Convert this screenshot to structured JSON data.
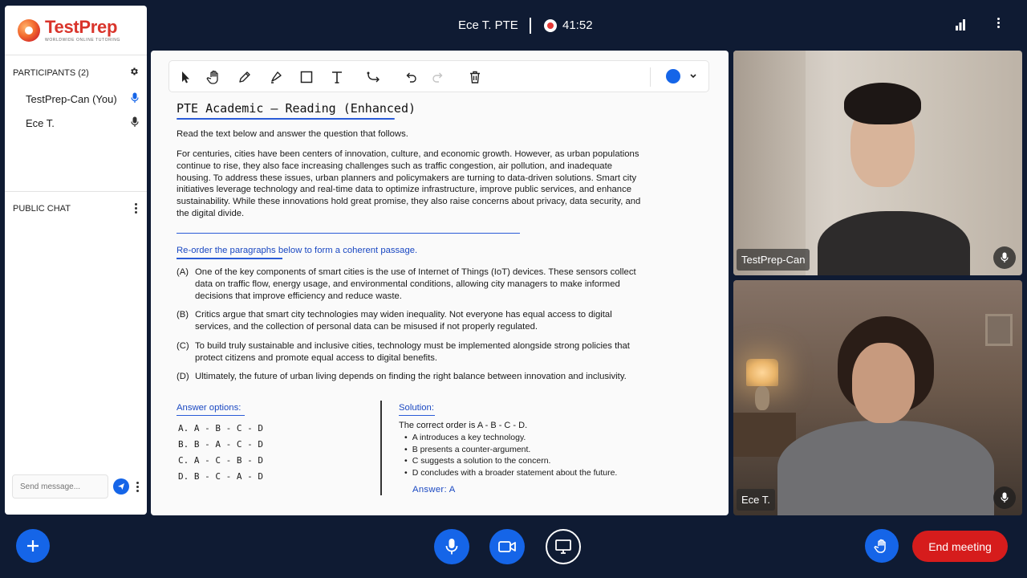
{
  "brand": {
    "title": "TestPrep",
    "subtitle": "WORLDWIDE ONLINE TUTORING"
  },
  "header": {
    "title": "Ece T. PTE",
    "timer": "41:52"
  },
  "participants": {
    "heading": "PARTICIPANTS (2)",
    "list": [
      {
        "name": "TestPrep-Can (You)",
        "mic_color": "#1565e8"
      },
      {
        "name": "Ece T.",
        "mic_color": "#333333"
      }
    ]
  },
  "chat": {
    "heading": "PUBLIC CHAT",
    "placeholder": "Send message..."
  },
  "whiteboard": {
    "title": "PTE  Academic  –  Reading  (Enhanced)",
    "intro": "Read the text below and answer the question that follows.",
    "passage": "For centuries, cities have been centers of innovation, culture, and economic growth. However, as urban populations continue to rise, they also face increasing challenges such as traffic congestion, air pollution, and inadequate housing. To address these issues, urban planners and policymakers are turning to data-driven solutions. Smart city initiatives leverage technology and real-time data to optimize infrastructure, improve public services, and enhance sustainability. While these innovations hold great promise, they also raise concerns about privacy, data security, and the digital divide.",
    "instruction": "Re-order the paragraphs below to form a coherent passage.",
    "options": [
      {
        "letter": "(A)",
        "text": "One of the key components of smart cities is the use of Internet of Things (IoT) devices. These sensors collect data on traffic flow, energy usage, and environmental conditions, allowing city managers to make informed decisions that improve efficiency and reduce waste."
      },
      {
        "letter": "(B)",
        "text": "Critics argue that smart city technologies may widen inequality. Not everyone has equal access to digital services, and the collection of personal data can be misused if not properly regulated."
      },
      {
        "letter": "(C)",
        "text": "To build truly sustainable and inclusive cities, technology must be implemented alongside strong policies that protect citizens and promote equal access to digital benefits."
      },
      {
        "letter": "(D)",
        "text": "Ultimately, the future of urban living depends on finding the right balance between innovation and inclusivity."
      }
    ],
    "answer_heading": "Answer options:",
    "answers": [
      "A.  A - B - C - D",
      "B.  B - A - C - D",
      "C.  A - C - B - D",
      "D.  B - C - A - D"
    ],
    "solution_heading": "Solution:",
    "solution_intro": "The correct order is A - B - C - D.",
    "solution_points": [
      "A introduces a key technology.",
      "B presents a counter-argument.",
      "C suggests a solution to the concern.",
      "D concludes with a broader statement about the future."
    ],
    "final_answer": "Answer:  A",
    "pen_color": "#1565e8"
  },
  "videos": [
    {
      "name": "TestPrep-Can"
    },
    {
      "name": "Ece T."
    }
  ],
  "controls": {
    "end_label": "End meeting"
  },
  "colors": {
    "accent": "#1565e8",
    "danger": "#d61c1c",
    "background": "#0f1b33"
  }
}
